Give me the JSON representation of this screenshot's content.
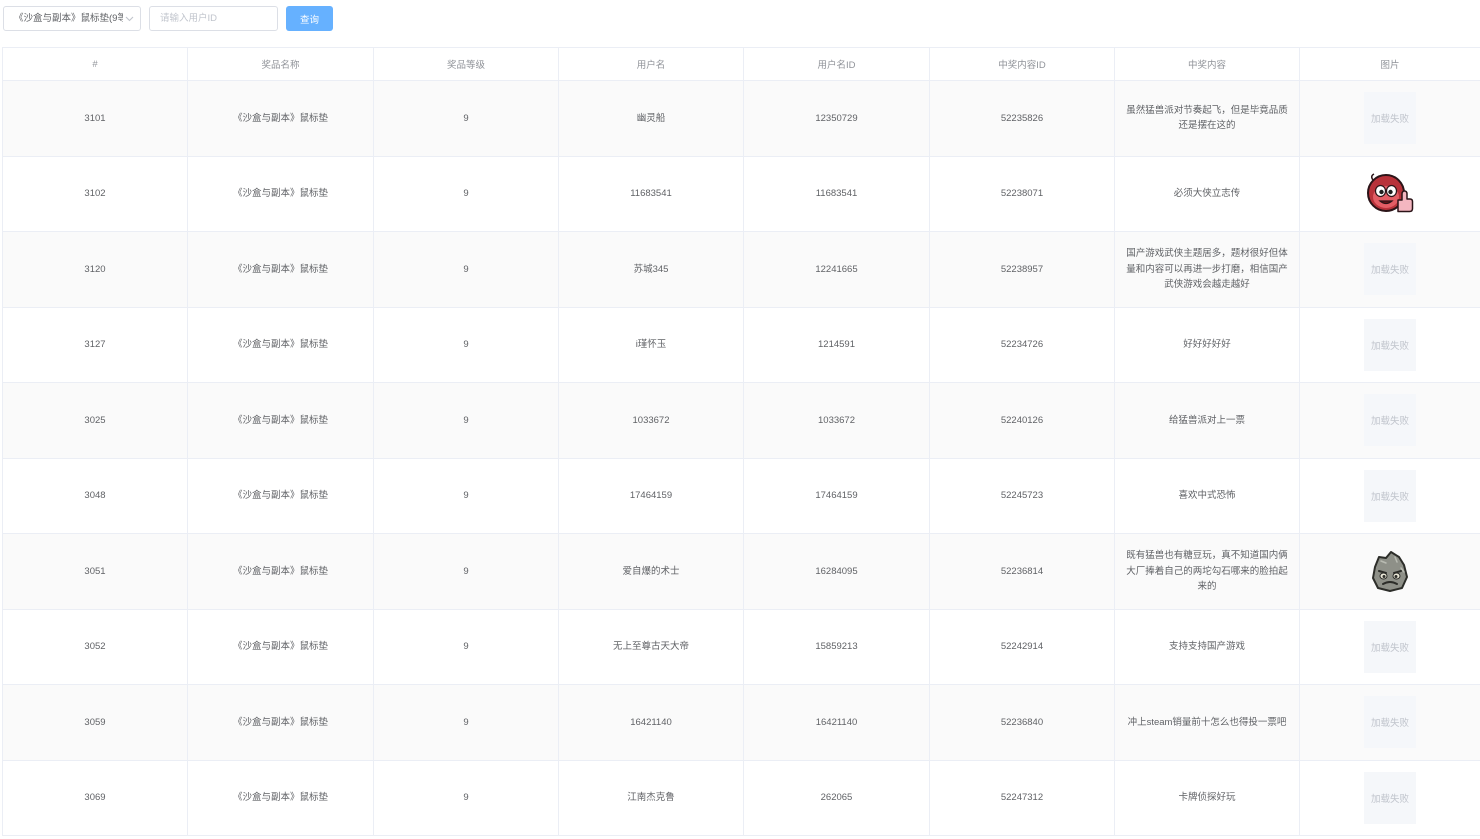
{
  "toolbar": {
    "prize_select": {
      "value": "《沙盒与副本》鼠标垫(9等"
    },
    "user_id_input": {
      "placeholder": "请输入用户ID"
    },
    "query_button": {
      "label": "查询"
    }
  },
  "icons": {
    "prize_select_chevron": "chevron-down-icon"
  },
  "colors": {
    "primary_button": "#66b1ff",
    "table_border": "#ebeef5",
    "row_stripe": "#fafafa"
  },
  "table": {
    "columns": [
      "#",
      "奖品名称",
      "奖品等级",
      "用户名",
      "用户名ID",
      "中奖内容ID",
      "中奖内容",
      "图片"
    ],
    "image_fail_text": "加载失败",
    "rows": [
      {
        "index": "3101",
        "prize_name": "《沙盒与副本》鼠标垫",
        "prize_level": "9",
        "username": "幽灵船",
        "user_id": "12350729",
        "content_id": "52235826",
        "content": "虽然猛兽派对节奏起飞，但是毕竟品质还是摆在这的",
        "image": {
          "loaded": false
        }
      },
      {
        "index": "3102",
        "prize_name": "《沙盒与副本》鼠标垫",
        "prize_level": "9",
        "username": "11683541",
        "user_id": "11683541",
        "content_id": "52238071",
        "content": "必须大侠立志传",
        "image": {
          "loaded": true,
          "icon": "red-mascot-icon"
        }
      },
      {
        "index": "3120",
        "prize_name": "《沙盒与副本》鼠标垫",
        "prize_level": "9",
        "username": "苏城345",
        "user_id": "12241665",
        "content_id": "52238957",
        "content": "国产游戏武侠主题居多，题材很好但体量和内容可以再进一步打磨，相信国产武侠游戏会越走越好",
        "image": {
          "loaded": false
        }
      },
      {
        "index": "3127",
        "prize_name": "《沙盒与副本》鼠标垫",
        "prize_level": "9",
        "username": "i瑾怀玉",
        "user_id": "1214591",
        "content_id": "52234726",
        "content": "好好好好好",
        "image": {
          "loaded": false
        }
      },
      {
        "index": "3025",
        "prize_name": "《沙盒与副本》鼠标垫",
        "prize_level": "9",
        "username": "1033672",
        "user_id": "1033672",
        "content_id": "52240126",
        "content": "给猛兽派对上一票",
        "image": {
          "loaded": false
        }
      },
      {
        "index": "3048",
        "prize_name": "《沙盒与副本》鼠标垫",
        "prize_level": "9",
        "username": "17464159",
        "user_id": "17464159",
        "content_id": "52245723",
        "content": "喜欢中式恐怖",
        "image": {
          "loaded": false
        }
      },
      {
        "index": "3051",
        "prize_name": "《沙盒与副本》鼠标垫",
        "prize_level": "9",
        "username": "爱自爆的术士",
        "user_id": "16284095",
        "content_id": "52236814",
        "content": "既有猛兽也有糖豆玩，真不知道国内俩大厂捧着自己的两坨勾石哪来的脸拍起来的",
        "image": {
          "loaded": true,
          "icon": "gray-rock-mascot-icon"
        }
      },
      {
        "index": "3052",
        "prize_name": "《沙盒与副本》鼠标垫",
        "prize_level": "9",
        "username": "无上至尊古天大帝",
        "user_id": "15859213",
        "content_id": "52242914",
        "content": "支持支持国产游戏",
        "image": {
          "loaded": false
        }
      },
      {
        "index": "3059",
        "prize_name": "《沙盒与副本》鼠标垫",
        "prize_level": "9",
        "username": "16421140",
        "user_id": "16421140",
        "content_id": "52236840",
        "content": "冲上steam销量前十怎么也得投一票吧",
        "image": {
          "loaded": false
        }
      },
      {
        "index": "3069",
        "prize_name": "《沙盒与副本》鼠标垫",
        "prize_level": "9",
        "username": "江南杰克鲁",
        "user_id": "262065",
        "content_id": "52247312",
        "content": "卡牌侦探好玩",
        "image": {
          "loaded": false
        }
      }
    ]
  }
}
